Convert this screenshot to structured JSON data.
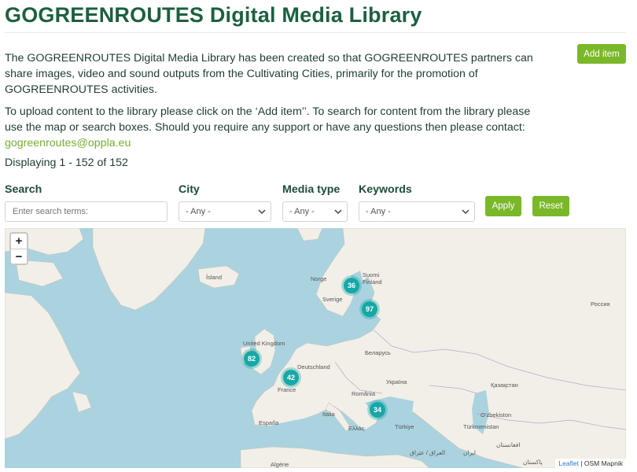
{
  "header": {
    "title": "GOGREENROUTES Digital Media Library"
  },
  "actions": {
    "add_item": "Add item"
  },
  "intro": {
    "paragraph1": "The GOGREENROUTES Digital Media Library has been created so that GOGREENROUTES partners can share images, video and sound outputs from the Cultivating Cities, primarily for the promotion of GOGREENROUTES activities.",
    "paragraph2": "To upload content to the library please click on the ‘Add item’’. To search for content from the library please use the map or search boxes. Should you require any support or have any questions then please contact:",
    "contact_email": "gogreenroutes@oppla.eu"
  },
  "results": {
    "displaying": "Displaying 1 - 152 of 152"
  },
  "filters": {
    "search_label": "Search",
    "search_placeholder": "Enter search terms:",
    "city_label": "City",
    "city_value": "- Any -",
    "media_type_label": "Media type",
    "media_type_value": "- Any -",
    "keywords_label": "Keywords",
    "keywords_value": "- Any -",
    "apply": "Apply",
    "reset": "Reset"
  },
  "map": {
    "zoom_in": "+",
    "zoom_out": "−",
    "attribution_link": "Leaflet",
    "attribution_text": " | OSM Mapnik",
    "clusters": [
      {
        "name": "cluster-nordic",
        "count": "36"
      },
      {
        "name": "cluster-finland",
        "count": "97"
      },
      {
        "name": "cluster-uk",
        "count": "82"
      },
      {
        "name": "cluster-france",
        "count": "42"
      },
      {
        "name": "cluster-turkey",
        "count": "34"
      }
    ],
    "labels": {
      "island": "Ísland",
      "norge": "Norge",
      "suomi": "Suomi",
      "finland": "Finland",
      "sverige": "Sverige",
      "rossiya": "Россия",
      "uk": "United Kingdom",
      "belarus": "Беларусь",
      "deutschland": "Deutschland",
      "ukraina": "Україна",
      "kazakhstan": "Қазақстан",
      "france": "France",
      "romania": "România",
      "italia": "Italia",
      "espana": "España",
      "ellas": "Ελλάς",
      "turkiye": "Türkiye",
      "ozbekiston": "O‘zbekiston",
      "turkmenistan": "Türkmenistan",
      "algerie": "Algérie",
      "iraq": "العراق / عێراق",
      "iran": "ایران",
      "afghanistan": "افغانستان",
      "pakistan": "پاکستان"
    }
  }
}
